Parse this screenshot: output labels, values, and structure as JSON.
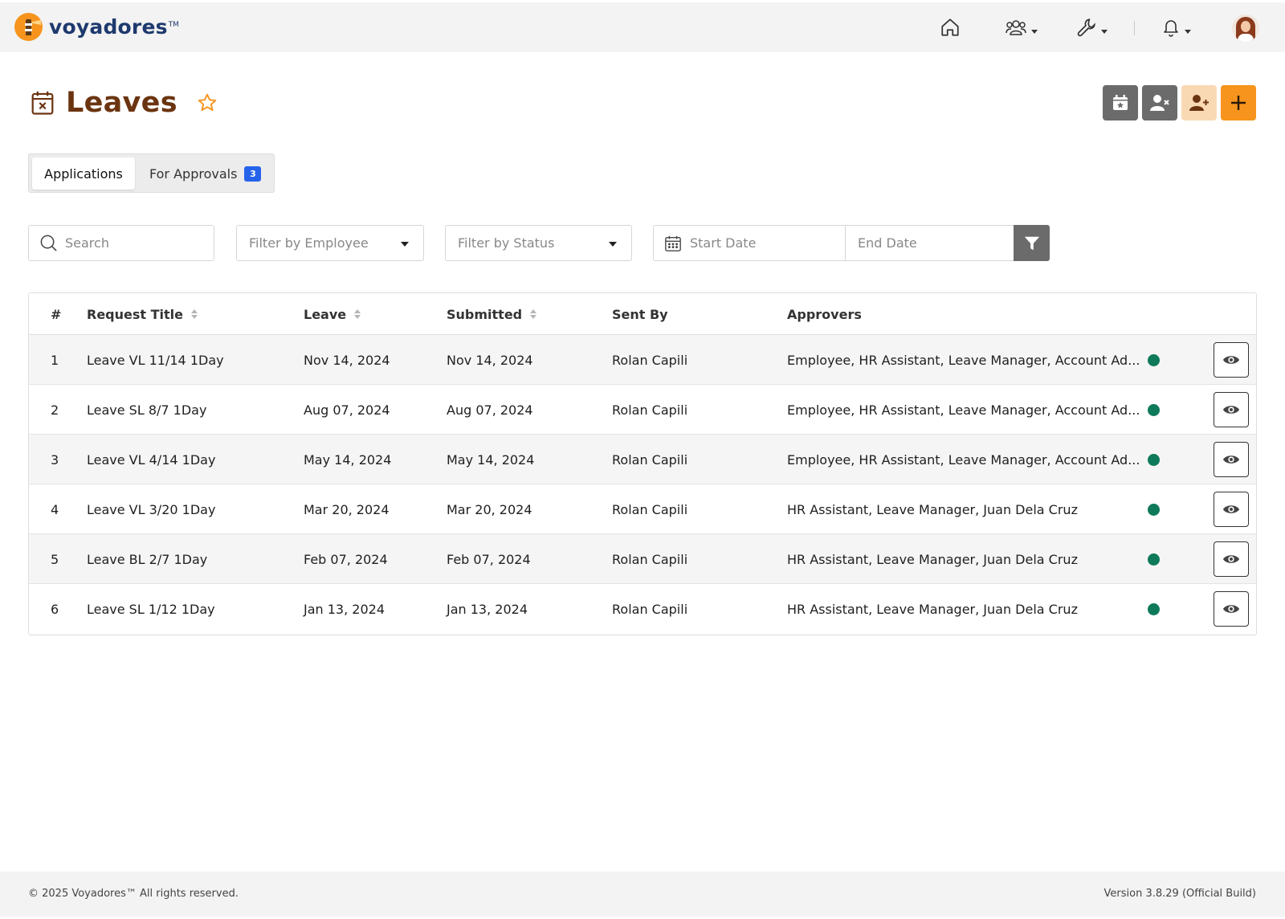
{
  "brand": {
    "name": "voyadores",
    "tm": "TM"
  },
  "page": {
    "title": "Leaves"
  },
  "tabs": [
    {
      "label": "Applications",
      "active": true
    },
    {
      "label": "For Approvals",
      "badge": "3",
      "active": false
    }
  ],
  "filters": {
    "search_placeholder": "Search",
    "employee_placeholder": "Filter by Employee",
    "status_placeholder": "Filter by Status",
    "start_date_placeholder": "Start Date",
    "end_date_placeholder": "End Date"
  },
  "table": {
    "headers": {
      "num": "#",
      "title": "Request Title",
      "leave": "Leave",
      "submitted": "Submitted",
      "sent_by": "Sent By",
      "approvers": "Approvers"
    },
    "rows": [
      {
        "num": "1",
        "title": "Leave VL 11/14 1Day",
        "leave": "Nov 14, 2024",
        "submitted": "Nov 14, 2024",
        "sent_by": "Rolan Capili",
        "approvers": "Employee, HR Assistant, Leave Manager, Account Ad..."
      },
      {
        "num": "2",
        "title": "Leave SL 8/7 1Day",
        "leave": "Aug 07, 2024",
        "submitted": "Aug 07, 2024",
        "sent_by": "Rolan Capili",
        "approvers": "Employee, HR Assistant, Leave Manager, Account Ad..."
      },
      {
        "num": "3",
        "title": "Leave VL 4/14 1Day",
        "leave": "May 14, 2024",
        "submitted": "May 14, 2024",
        "sent_by": "Rolan Capili",
        "approvers": "Employee, HR Assistant, Leave Manager, Account Ad..."
      },
      {
        "num": "4",
        "title": "Leave VL 3/20 1Day",
        "leave": "Mar 20, 2024",
        "submitted": "Mar 20, 2024",
        "sent_by": "Rolan Capili",
        "approvers": "HR Assistant, Leave Manager, Juan Dela Cruz"
      },
      {
        "num": "5",
        "title": "Leave BL 2/7 1Day",
        "leave": "Feb 07, 2024",
        "submitted": "Feb 07, 2024",
        "sent_by": "Rolan Capili",
        "approvers": "HR Assistant, Leave Manager, Juan Dela Cruz"
      },
      {
        "num": "6",
        "title": "Leave SL 1/12 1Day",
        "leave": "Jan 13, 2024",
        "submitted": "Jan 13, 2024",
        "sent_by": "Rolan Capili",
        "approvers": "HR Assistant, Leave Manager, Juan Dela Cruz"
      }
    ]
  },
  "footer": {
    "copyright": "© 2025 Voyadores™ All rights reserved.",
    "version": "Version 3.8.29 (Official Build)"
  },
  "colors": {
    "brand_orange": "#f7941d",
    "title_brown": "#6b3410",
    "status_green": "#0e7a5a",
    "badge_blue": "#2563eb"
  },
  "icons": {
    "nav": [
      "home-icon",
      "users-icon",
      "wrench-icon",
      "bell-icon"
    ],
    "actions": [
      "calendar-star-icon",
      "user-remove-icon",
      "user-add-icon",
      "plus-icon"
    ]
  }
}
